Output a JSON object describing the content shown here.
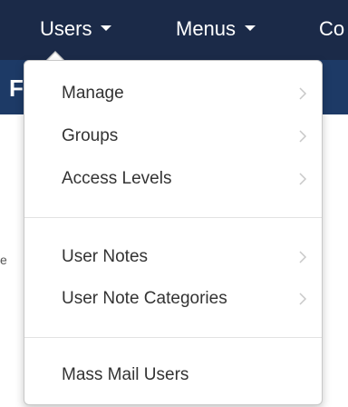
{
  "navbar": {
    "items": [
      {
        "label": "Users"
      },
      {
        "label": "Menus"
      },
      {
        "label": "Co"
      }
    ]
  },
  "subbar": {
    "partial_title": "F"
  },
  "background": {
    "fragment": "e"
  },
  "dropdown": {
    "groups": [
      {
        "items": [
          {
            "label": "Manage",
            "has_submenu": true
          },
          {
            "label": "Groups",
            "has_submenu": true
          },
          {
            "label": "Access Levels",
            "has_submenu": true
          }
        ]
      },
      {
        "items": [
          {
            "label": "User Notes",
            "has_submenu": true
          },
          {
            "label": "User Note Categories",
            "has_submenu": true
          }
        ]
      },
      {
        "items": [
          {
            "label": "Mass Mail Users",
            "has_submenu": false
          }
        ]
      }
    ]
  },
  "colors": {
    "navbar_bg": "#1b2a48",
    "subbar_bg": "#1d3a66",
    "menu_text": "#333333",
    "chevron": "#c8c8c8"
  },
  "icons": {
    "caret": "caret-down-icon",
    "submenu": "chevron-right-icon"
  }
}
